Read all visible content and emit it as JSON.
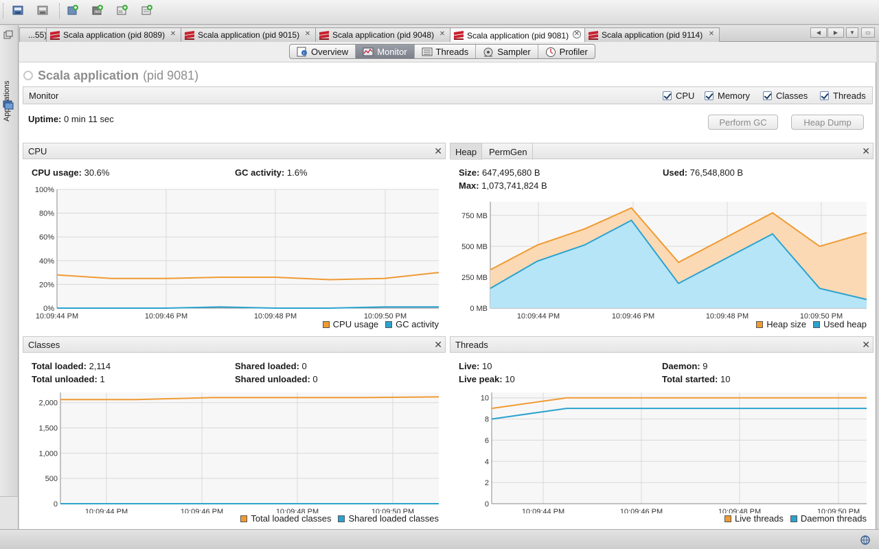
{
  "toolbar": {
    "icons": [
      "open-application-icon",
      "save-snapshot-icon",
      "add-jmx-connection-icon",
      "add-remote-host-icon",
      "add-snapshot-icon",
      "add-core-dump-icon"
    ]
  },
  "sidebar": {
    "label": "Applications"
  },
  "tabs": [
    {
      "label": "...55)",
      "active": false
    },
    {
      "label": "Scala application (pid 8089)",
      "active": false
    },
    {
      "label": "Scala application (pid 9015)",
      "active": false
    },
    {
      "label": "Scala application (pid 9048)",
      "active": false
    },
    {
      "label": "Scala application (pid 9081)",
      "active": true
    },
    {
      "label": "Scala application (pid 9114)",
      "active": false
    }
  ],
  "views": [
    {
      "label": "Overview",
      "icon": "overview-icon",
      "active": false
    },
    {
      "label": "Monitor",
      "icon": "monitor-icon",
      "active": true
    },
    {
      "label": "Threads",
      "icon": "threads-icon",
      "active": false
    },
    {
      "label": "Sampler",
      "icon": "sampler-icon",
      "active": false
    },
    {
      "label": "Profiler",
      "icon": "profiler-icon",
      "active": false
    }
  ],
  "app": {
    "name": "Scala application",
    "pid": "(pid 9081)"
  },
  "monitor": {
    "title": "Monitor",
    "checkboxes": [
      {
        "label": "CPU",
        "checked": true
      },
      {
        "label": "Memory",
        "checked": true
      },
      {
        "label": "Classes",
        "checked": true
      },
      {
        "label": "Threads",
        "checked": true
      }
    ],
    "uptime_label": "Uptime:",
    "uptime_value": "0 min 11 sec",
    "perform_gc": "Perform GC",
    "heap_dump": "Heap Dump"
  },
  "cpu": {
    "title": "CPU",
    "usage_label": "CPU usage:",
    "usage_value": "30.6%",
    "gc_label": "GC activity:",
    "gc_value": "1.6%"
  },
  "heap": {
    "tab_heap": "Heap",
    "tab_permgen": "PermGen",
    "size_label": "Size:",
    "size_value": "647,495,680 B",
    "used_label": "Used:",
    "used_value": "76,548,800 B",
    "max_label": "Max:",
    "max_value": "1,073,741,824 B"
  },
  "classes": {
    "title": "Classes",
    "total_loaded_label": "Total loaded:",
    "total_loaded_value": "2,114",
    "shared_loaded_label": "Shared loaded:",
    "shared_loaded_value": "0",
    "total_unloaded_label": "Total unloaded:",
    "total_unloaded_value": "1",
    "shared_unloaded_label": "Shared unloaded:",
    "shared_unloaded_value": "0"
  },
  "threads": {
    "title": "Threads",
    "live_label": "Live:",
    "live_value": "10",
    "daemon_label": "Daemon:",
    "daemon_value": "9",
    "peak_label": "Live peak:",
    "peak_value": "10",
    "started_label": "Total started:",
    "started_value": "10"
  },
  "colors": {
    "orange": "#f09a32",
    "blue": "#2ba2cf",
    "heap_fill": "#fbd9b4",
    "used_fill": "#b6e5f7",
    "grid": "#d8d8d8"
  },
  "chart_data": [
    {
      "id": "cpu",
      "type": "line",
      "x": [
        "10:09:43",
        "10:09:44",
        "10:09:45",
        "10:09:46",
        "10:09:47",
        "10:09:48",
        "10:09:49",
        "10:09:50",
        "10:09:51"
      ],
      "xticks": [
        "10:09:44 PM",
        "10:09:46 PM",
        "10:09:48 PM",
        "10:09:50 PM"
      ],
      "yticks": [
        "0%",
        "20%",
        "40%",
        "60%",
        "80%",
        "100%"
      ],
      "ylim": [
        0,
        100
      ],
      "series": [
        {
          "name": "CPU usage",
          "color": "#f09a32",
          "values": [
            28,
            25,
            25,
            26,
            26,
            24,
            25,
            30
          ],
          "x_index": [
            0,
            1,
            2,
            3,
            4,
            5,
            6,
            7
          ]
        },
        {
          "name": "GC activity",
          "color": "#2ba2cf",
          "values": [
            0,
            0,
            0,
            1,
            0,
            0,
            1,
            1
          ],
          "x_index": [
            0,
            1,
            2,
            3,
            4,
            5,
            6,
            7
          ]
        }
      ]
    },
    {
      "id": "heap",
      "type": "area",
      "yticks": [
        "0 MB",
        "250 MB",
        "500 MB",
        "750 MB"
      ],
      "ylim": [
        0,
        860
      ],
      "xticks": [
        "10:09:44 PM",
        "10:09:46 PM",
        "10:09:48 PM",
        "10:09:50 PM"
      ],
      "series": [
        {
          "name": "Heap size",
          "color": "#f09a32",
          "values": [
            310,
            510,
            640,
            810,
            370,
            570,
            770,
            500,
            610
          ]
        },
        {
          "name": "Used heap",
          "color": "#2ba2cf",
          "values": [
            160,
            380,
            510,
            710,
            200,
            400,
            600,
            160,
            70
          ]
        }
      ]
    },
    {
      "id": "classes",
      "type": "line",
      "yticks": [
        "0",
        "500",
        "1,000",
        "1,500",
        "2,000"
      ],
      "ylim": [
        0,
        2200
      ],
      "xticks": [
        "10:09:44 PM",
        "10:09:46 PM",
        "10:09:48 PM",
        "10:09:50 PM"
      ],
      "series": [
        {
          "name": "Total loaded classes",
          "color": "#f09a32",
          "values": [
            2060,
            2060,
            2100,
            2100,
            2100,
            2114
          ]
        },
        {
          "name": "Shared loaded classes",
          "color": "#2ba2cf",
          "values": [
            0,
            0,
            0,
            0,
            0,
            0
          ]
        }
      ]
    },
    {
      "id": "threads",
      "type": "line",
      "yticks": [
        "0",
        "2",
        "4",
        "6",
        "8",
        "10"
      ],
      "ylim": [
        0,
        10.5
      ],
      "xticks": [
        "10:09:44 PM",
        "10:09:46 PM",
        "10:09:48 PM",
        "10:09:50 PM"
      ],
      "series": [
        {
          "name": "Live threads",
          "color": "#f09a32",
          "values": [
            9,
            10,
            10,
            10,
            10,
            10
          ]
        },
        {
          "name": "Daemon threads",
          "color": "#2ba2cf",
          "values": [
            8,
            9,
            9,
            9,
            9,
            9
          ]
        }
      ]
    }
  ]
}
